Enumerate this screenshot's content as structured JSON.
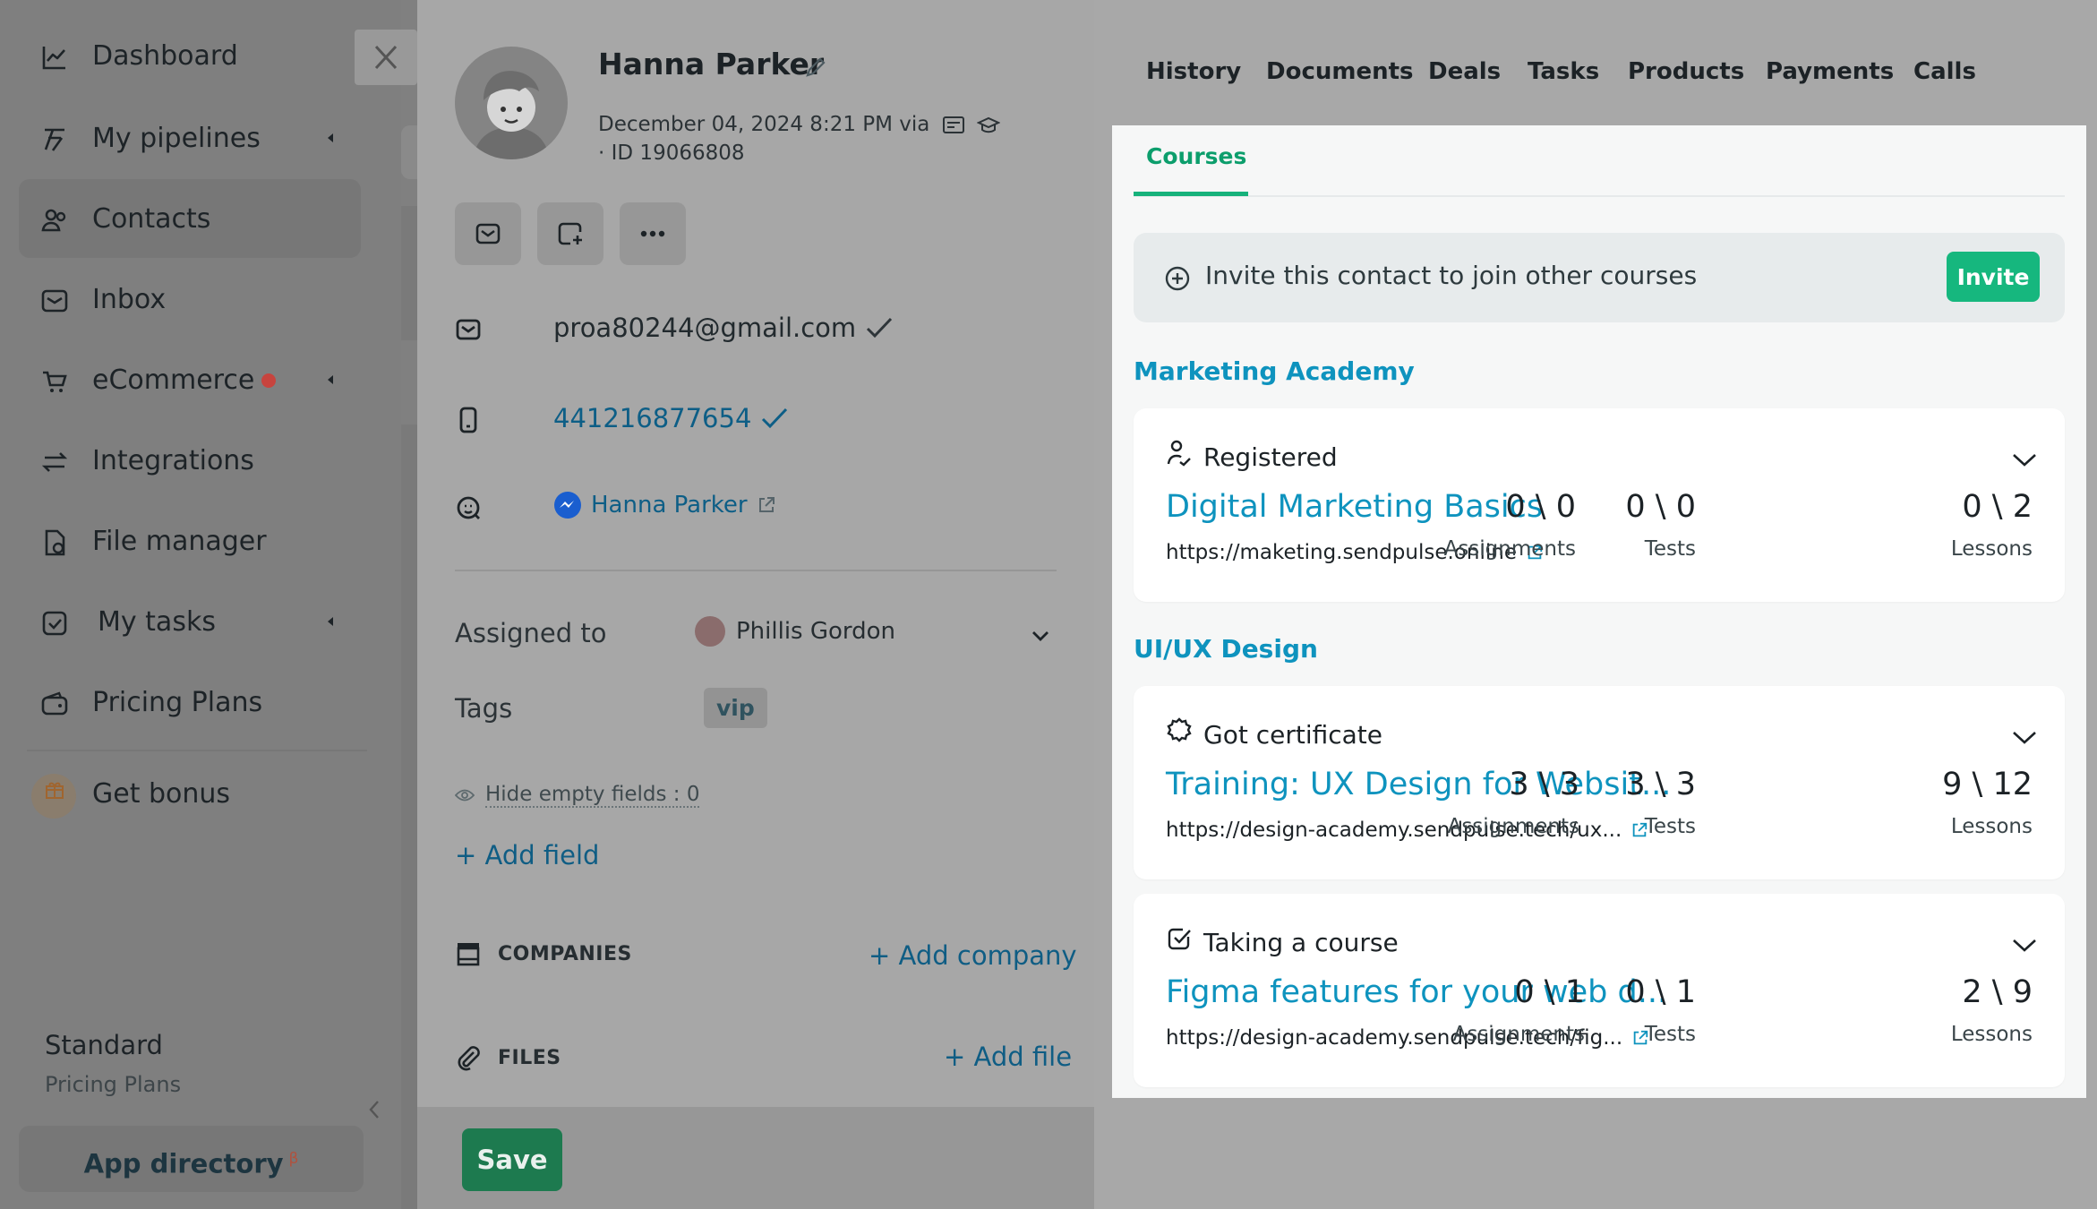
{
  "sidebar": {
    "items": [
      {
        "label": "Dashboard",
        "icon": "chart-line-icon"
      },
      {
        "label": "My pipelines",
        "icon": "pipeline-icon"
      },
      {
        "label": "Contacts",
        "icon": "contacts-icon"
      },
      {
        "label": "Inbox",
        "icon": "inbox-icon"
      },
      {
        "label": "eCommerce",
        "icon": "cart-icon"
      },
      {
        "label": "Integrations",
        "icon": "arrows-swap-icon"
      },
      {
        "label": "File manager",
        "icon": "file-icon"
      },
      {
        "label": "My tasks",
        "icon": "checkbox-icon"
      },
      {
        "label": "Pricing Plans",
        "icon": "wallet-icon"
      },
      {
        "label": "Get bonus",
        "icon": "gift-icon"
      }
    ],
    "active": "Contacts",
    "plan_name": "Standard",
    "plan_sub": "Pricing Plans",
    "app_directory": "App directory",
    "beta_mark": "β"
  },
  "contact": {
    "name": "Hanna Parker",
    "created": "December 04, 2024 8:21 PM via",
    "id": "ID 19066808",
    "email": "proa80244@gmail.com",
    "phone": "441216877654",
    "messenger": "Hanna Parker",
    "assigned_label": "Assigned to",
    "assignee": "Phillis Gordon",
    "tags_label": "Tags",
    "tag": "vip",
    "hide_empty": "Hide empty fields : 0",
    "add_field": "+ Add field",
    "companies_label": "COMPANIES",
    "add_company": "+ Add company",
    "files_label": "FILES",
    "add_file": "+ Add file",
    "save": "Save"
  },
  "tabs": [
    "History",
    "Documents",
    "Deals",
    "Tasks",
    "Products",
    "Payments",
    "Calls"
  ],
  "courses": {
    "subtab": "Courses",
    "invite_text": "Invite this contact to join other courses",
    "invite_button": "Invite",
    "groups": [
      {
        "title": "Marketing Academy",
        "cards": [
          {
            "status": "Registered",
            "title": "Digital Marketing Basics",
            "url": "https://maketing.sendpulse.online",
            "assignments": "0 \\ 0",
            "tests": "0 \\ 0",
            "lessons": "0 \\ 2"
          }
        ]
      },
      {
        "title": "UI/UX Design",
        "cards": [
          {
            "status": "Got certificate",
            "title": "Training: UX Design for Websit...",
            "url": "https://design-academy.sendpulse.tech/ux...",
            "assignments": "3 \\ 3",
            "tests": "3 \\ 3",
            "lessons": "9 \\ 12"
          },
          {
            "status": "Taking a course",
            "title": "Figma features for your web d...",
            "url": "https://design-academy.sendpulse.tech/fig...",
            "assignments": "0 \\ 1",
            "tests": "0 \\ 1",
            "lessons": "2 \\ 9"
          }
        ]
      }
    ],
    "stat_labels": {
      "assignments": "Assignments",
      "tests": "Tests",
      "lessons": "Lessons"
    }
  },
  "colors": {
    "accent_green": "#16b77e",
    "link_blue": "#0e93be",
    "save_green": "#1d7a4f"
  }
}
